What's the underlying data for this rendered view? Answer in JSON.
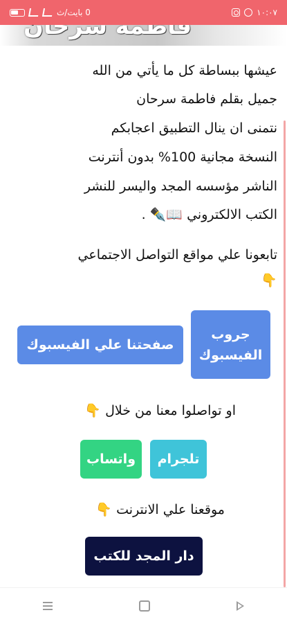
{
  "status_bar": {
    "time": "١٠:٠٧",
    "network_speed": "0 بايت/ث",
    "background_color": "#f0656c"
  },
  "header": {
    "image_title": "فاطمة سرحان"
  },
  "description_lines": [
    "عيشها ببساطة كل ما يأتي من الله",
    "جميل بقلم فاطمة سرحان",
    "نتمنى ان ينال التطبيق اعجابكم",
    "النسخة مجانية 100% بدون أنترنت",
    "الناشر مؤسسه المجد واليسر  للنشر",
    "الكتب الالكتروني 📖✒️ ."
  ],
  "social_prompt": "تابعونا علي مواقع التواصل الاجتماعي",
  "social_prompt_emoji": "👇",
  "buttons": {
    "facebook_group": "جروب الفيسبوك",
    "facebook_page": "صفحتنا علي الفيسبوك",
    "telegram": "تلجرام",
    "whatsapp": "واتساب",
    "website": "دار المجد للكتب"
  },
  "contact_prompt": "او تواصلوا معنا من خلال 👇",
  "website_prompt": "موقعنا علي الانترنت 👇",
  "colors": {
    "facebook": "#5b8be6",
    "telegram": "#3fc4d9",
    "whatsapp": "#33d483",
    "website": "#0d1240"
  },
  "icons": {
    "nav_recent": "recent-apps-icon",
    "nav_home": "home-icon",
    "nav_back": "back-icon"
  }
}
